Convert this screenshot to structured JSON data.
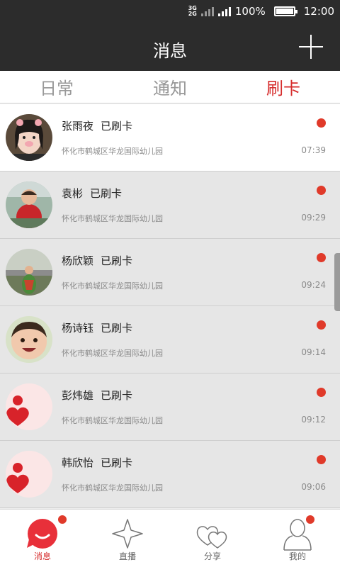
{
  "status_bar": {
    "net_top": "3G",
    "net_bottom": "2G",
    "battery_percent": "100%",
    "battery_level": 1.0,
    "time": "12:00"
  },
  "header": {
    "title": "消息",
    "add_icon": "plus-icon"
  },
  "tabs": [
    {
      "label": "日常",
      "active": false
    },
    {
      "label": "通知",
      "active": false
    },
    {
      "label": "刷卡",
      "active": true
    }
  ],
  "messages": [
    {
      "name": "张雨夜",
      "status": "已刷卡",
      "school": "怀化市鹤城区华龙国际幼儿园",
      "time": "07:39",
      "unread": true,
      "avatar": "photo"
    },
    {
      "name": "袁彬",
      "status": "已刷卡",
      "school": "怀化市鹤城区华龙国际幼儿园",
      "time": "09:29",
      "unread": true,
      "avatar": "photo"
    },
    {
      "name": "杨欣颖",
      "status": "已刷卡",
      "school": "怀化市鹤城区华龙国际幼儿园",
      "time": "09:24",
      "unread": true,
      "avatar": "photo"
    },
    {
      "name": "杨诗钰",
      "status": "已刷卡",
      "school": "怀化市鹤城区华龙国际幼儿园",
      "time": "09:14",
      "unread": true,
      "avatar": "photo"
    },
    {
      "name": "彭炜雄",
      "status": "已刷卡",
      "school": "怀化市鹤城区华龙国际幼儿园",
      "time": "09:12",
      "unread": true,
      "avatar": "default-heart-person"
    },
    {
      "name": "韩欣怡",
      "status": "已刷卡",
      "school": "怀化市鹤城区华龙国际幼儿园",
      "time": "09:06",
      "unread": true,
      "avatar": "default-heart-person"
    }
  ],
  "bottom_nav": [
    {
      "label": "消息",
      "icon": "chat-bubble-icon",
      "active": true,
      "badge": true
    },
    {
      "label": "直播",
      "icon": "star-icon",
      "active": false,
      "badge": false
    },
    {
      "label": "分享",
      "icon": "hearts-icon",
      "active": false,
      "badge": false
    },
    {
      "label": "我的",
      "icon": "person-icon",
      "active": false,
      "badge": true
    }
  ],
  "colors": {
    "header_bg": "#2c2c2c",
    "accent_red": "#d62c2c",
    "unread_dot": "#e03a2a",
    "list_bg": "#e6e6e6"
  }
}
